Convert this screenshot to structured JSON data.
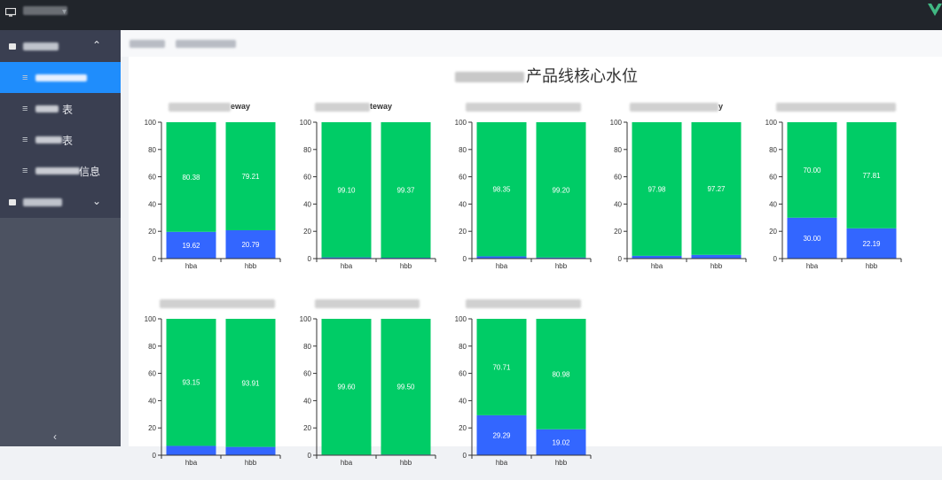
{
  "header": {
    "caret": "▾"
  },
  "sidebar": {
    "groups": [
      {
        "chevron": "⌃"
      },
      {
        "chevron": "⌄"
      }
    ],
    "items": [
      {
        "suffix": ""
      },
      {
        "suffix": "表"
      },
      {
        "suffix": "表"
      },
      {
        "suffix": "信息"
      }
    ],
    "collapse": "‹"
  },
  "page": {
    "title_suffix": "产品线核心水位"
  },
  "colors": {
    "green": "#00cc66",
    "blue": "#3366ff",
    "axis": "#333333"
  },
  "chart_data": [
    {
      "type": "bar",
      "title_suffix": "eway",
      "categories": [
        "hba",
        "hbb"
      ],
      "series": [
        {
          "values": [
            19.62,
            20.79
          ]
        },
        {
          "values": [
            80.38,
            79.21
          ]
        }
      ],
      "bottom_labels": [
        "19.62",
        "20.79"
      ],
      "top_labels": [
        "80.38",
        "79.21"
      ],
      "ylim": [
        0,
        100
      ],
      "yticks": [
        0,
        20,
        40,
        60,
        80,
        100
      ]
    },
    {
      "type": "bar",
      "title_suffix": "teway",
      "categories": [
        "hba",
        "hbb"
      ],
      "series": [
        {
          "values": [
            0.9,
            0.63
          ]
        },
        {
          "values": [
            99.1,
            99.37
          ]
        }
      ],
      "bottom_labels": [
        "",
        ""
      ],
      "top_labels": [
        "99.10",
        "99.37"
      ],
      "ylim": [
        0,
        100
      ],
      "yticks": [
        0,
        20,
        40,
        60,
        80,
        100
      ]
    },
    {
      "type": "bar",
      "title_suffix": "",
      "categories": [
        "hba",
        "hbb"
      ],
      "series": [
        {
          "values": [
            1.65,
            0.8
          ]
        },
        {
          "values": [
            98.35,
            99.2
          ]
        }
      ],
      "bottom_labels": [
        "",
        ""
      ],
      "top_labels": [
        "98.35",
        "99.20"
      ],
      "ylim": [
        0,
        100
      ],
      "yticks": [
        0,
        20,
        40,
        60,
        80,
        100
      ]
    },
    {
      "type": "bar",
      "title_suffix": "y",
      "categories": [
        "hba",
        "hbb"
      ],
      "series": [
        {
          "values": [
            2.02,
            2.73
          ]
        },
        {
          "values": [
            97.98,
            97.27
          ]
        }
      ],
      "bottom_labels": [
        "",
        ""
      ],
      "top_labels": [
        "97.98",
        "97.27"
      ],
      "ylim": [
        0,
        100
      ],
      "yticks": [
        0,
        20,
        40,
        60,
        80,
        100
      ]
    },
    {
      "type": "bar",
      "title_suffix": "",
      "categories": [
        "hba",
        "hbb"
      ],
      "series": [
        {
          "values": [
            30.0,
            22.19
          ]
        },
        {
          "values": [
            70.0,
            77.81
          ]
        }
      ],
      "bottom_labels": [
        "30.00",
        "22.19"
      ],
      "top_labels": [
        "70.00",
        "77.81"
      ],
      "ylim": [
        0,
        100
      ],
      "yticks": [
        0,
        20,
        40,
        60,
        80,
        100
      ]
    },
    {
      "type": "bar",
      "title_suffix": "",
      "categories": [
        "hba",
        "hbb"
      ],
      "series": [
        {
          "values": [
            6.85,
            6.09
          ]
        },
        {
          "values": [
            93.15,
            93.91
          ]
        }
      ],
      "bottom_labels": [
        "",
        ""
      ],
      "top_labels": [
        "93.15",
        "93.91"
      ],
      "ylim": [
        0,
        100
      ],
      "yticks": [
        0,
        20,
        40,
        60,
        80,
        100
      ]
    },
    {
      "type": "bar",
      "title_suffix": "",
      "categories": [
        "hba",
        "hbb"
      ],
      "series": [
        {
          "values": [
            0.4,
            0.5
          ]
        },
        {
          "values": [
            99.6,
            99.5
          ]
        }
      ],
      "bottom_labels": [
        "",
        ""
      ],
      "top_labels": [
        "99.60",
        "99.50"
      ],
      "ylim": [
        0,
        100
      ],
      "yticks": [
        0,
        20,
        40,
        60,
        80,
        100
      ]
    },
    {
      "type": "bar",
      "title_suffix": "",
      "categories": [
        "hba",
        "hbb"
      ],
      "series": [
        {
          "values": [
            29.29,
            19.02
          ]
        },
        {
          "values": [
            70.71,
            80.98
          ]
        }
      ],
      "bottom_labels": [
        "29.29",
        "19.02"
      ],
      "top_labels": [
        "70.71",
        "80.98"
      ],
      "ylim": [
        0,
        100
      ],
      "yticks": [
        0,
        20,
        40,
        60,
        80,
        100
      ]
    }
  ]
}
